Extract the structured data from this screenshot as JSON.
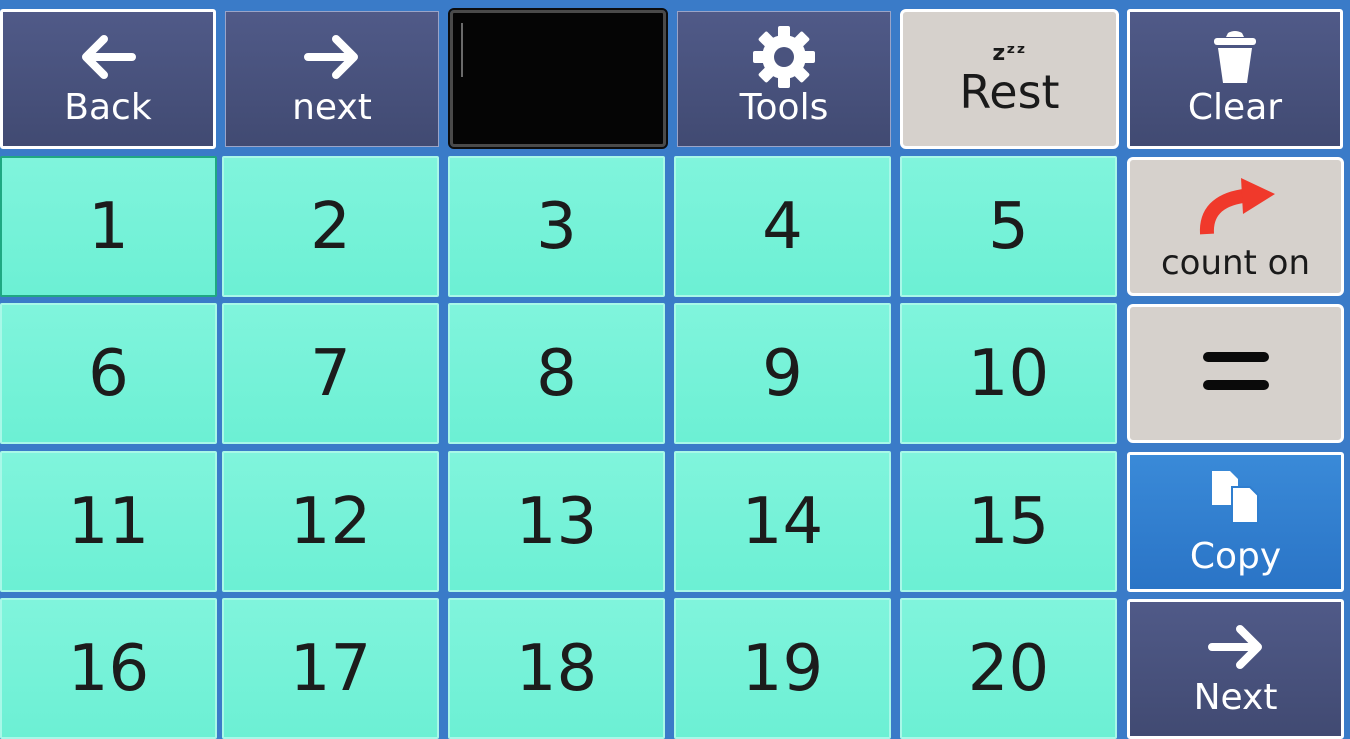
{
  "toolbar": {
    "back_label": "Back",
    "next_label": "next",
    "tools_label": "Tools",
    "rest_label": "Rest",
    "rest_icon_text": "zᶻᶻ",
    "clear_label": "Clear",
    "message_text": ""
  },
  "numbers": [
    "1",
    "2",
    "3",
    "4",
    "5",
    "6",
    "7",
    "8",
    "9",
    "10",
    "11",
    "12",
    "13",
    "14",
    "15",
    "16",
    "17",
    "18",
    "19",
    "20"
  ],
  "side": {
    "count_on_label": "count on",
    "copy_label": "Copy",
    "next_label": "Next"
  },
  "icons": {
    "back": "arrow-left-icon",
    "next": "arrow-right-icon",
    "tools": "gear-icon",
    "rest": "sleep-zzz-icon",
    "clear": "trash-icon",
    "count_on": "curved-arrow-icon",
    "equals": "equals-icon",
    "copy": "copy-icon",
    "next_page": "arrow-right-icon"
  },
  "colors": {
    "background": "#3a7bc8",
    "nav_button": "#4a537e",
    "number_button": "#76f2d8",
    "gray_button": "#d6d1cc",
    "copy_button": "#2f7ecf",
    "count_on_arrow": "#f0392b"
  }
}
